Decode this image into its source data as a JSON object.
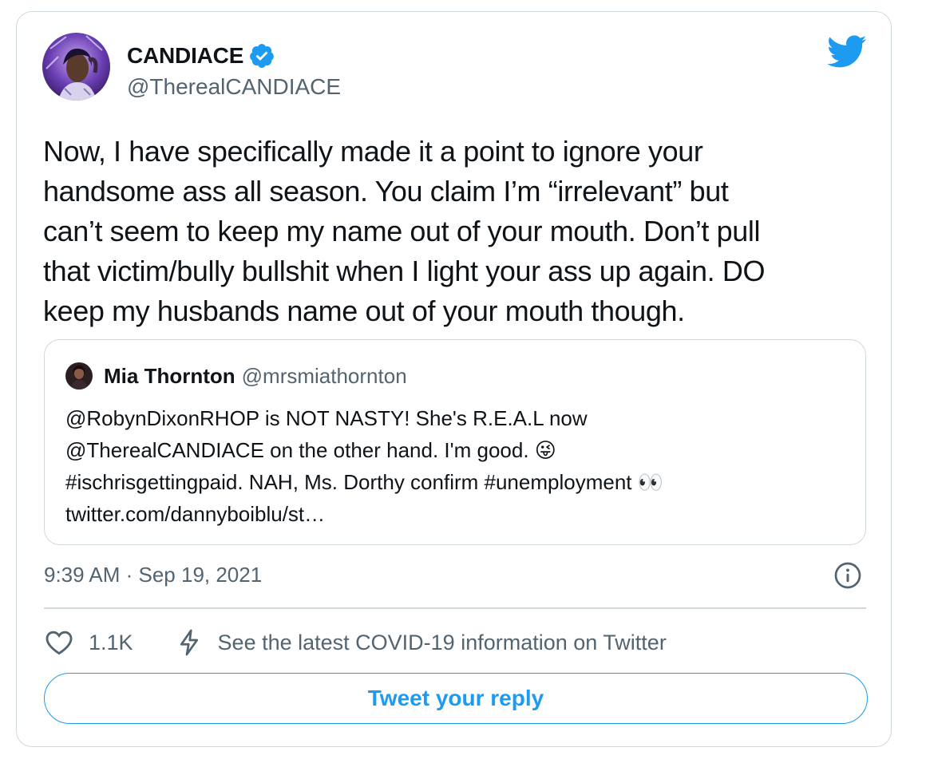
{
  "author": {
    "display_name": "CANDIACE",
    "handle": "@TherealCANDIACE",
    "verified": true
  },
  "tweet": {
    "text": "Now, I have specifically made it a point to ignore your\nhandsome ass all season. You claim I’m “irrelevant” but\ncan’t seem to keep my name out of your mouth. Don’t pull\nthat victim/bully bullshit when I light your ass up again. DO\nkeep my husbands name out of your mouth though.",
    "timestamp": "9:39 AM · Sep 19, 2021"
  },
  "quoted_tweet": {
    "display_name": "Mia Thornton",
    "handle": "@mrsmiathornton",
    "text": "@RobynDixonRHOP is NOT NASTY!  She's R.E.A.L now\n@TherealCANDIACE on the other hand.  I'm good. 😜\n#ischrisgettingpaid. NAH,  Ms. Dorthy confirm #unemployment 👀\ntwitter.com/dannyboiblu/st…"
  },
  "actions": {
    "like_count": "1.1K",
    "covid_link": "See the latest COVID-19 information on Twitter",
    "reply_button": "Tweet your reply"
  },
  "icons": {
    "brand": "twitter-bird-icon",
    "verified": "verified-badge-icon",
    "info": "info-icon",
    "like": "heart-icon",
    "covid": "lightning-bolt-icon"
  },
  "colors": {
    "accent": "#1d9bf0",
    "text": "#0f1419",
    "secondary_text": "#536471",
    "border": "#cfd9de"
  }
}
